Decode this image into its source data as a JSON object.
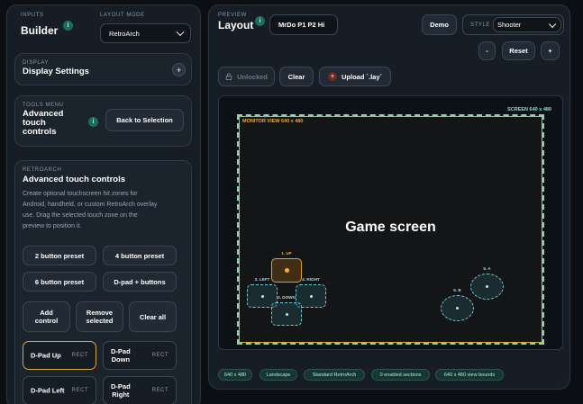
{
  "inputs": {
    "eyebrow": "INPUTS",
    "title": "Builder",
    "layout_mode_label": "LAYOUT MODE",
    "layout_mode_value": "RetroArch"
  },
  "display": {
    "eyebrow": "DISPLAY",
    "title": "Display Settings",
    "toggle": "+"
  },
  "tools": {
    "eyebrow": "TOOLS MENU",
    "title_line1": "Advanced",
    "title_line2": "touch",
    "title_line3": "controls",
    "back_label": "Back to Selection"
  },
  "retroarch": {
    "eyebrow": "RETROARCH",
    "title": "Advanced touch controls",
    "description_lines": [
      "Create optional touchscreen hit zones for",
      "Android, handheld, or custom RetroArch overlay",
      "use. Drag the selected touch zone on the",
      "preview to position it."
    ],
    "presets": [
      "2 button preset",
      "4 button preset",
      "6 button preset",
      "D-pad + buttons"
    ],
    "add_control": [
      "Add",
      "control"
    ],
    "remove_selected": [
      "Remove",
      "selected"
    ],
    "clear_all": "Clear all",
    "zones": [
      {
        "name": [
          "D-Pad Up"
        ],
        "type": "RECT",
        "active": true
      },
      {
        "name": [
          "D-Pad",
          "Down"
        ],
        "type": "RECT",
        "active": false
      },
      {
        "name": [
          "D-Pad Left"
        ],
        "type": "RECT",
        "active": false
      },
      {
        "name": [
          "D-Pad",
          "Right"
        ],
        "type": "RECT",
        "active": false
      }
    ]
  },
  "preview": {
    "eyebrow": "PREVIEW",
    "title": "Layout",
    "game_name": "MrDo P1 P2 Hi",
    "demo_label": "Demo",
    "style_label": "STYLE",
    "style_value": "Shooter",
    "zoom_out": "-",
    "reset_label": "Reset",
    "zoom_in": "+",
    "unlocked_label": "Unlocked",
    "clear_label": "Clear",
    "upload_label": "Upload `.lay`",
    "screen_label": "SCREEN 640 x 480",
    "monitor_label": "MONITOR VIEW 640 x 480",
    "game_screen_label": "Game screen",
    "zones": {
      "up": "1. UP",
      "left": "3. LEFT",
      "right": "4. RIGHT",
      "down": "2. DOWN",
      "a": "5. A",
      "b": "6. B"
    },
    "chips": [
      "640 x 480",
      "Landscape",
      "Standard RetroArch",
      "0 enabled sections",
      "640 x 480 view bounds"
    ]
  },
  "colors": {
    "accent_teal": "#6ec9d2",
    "accent_orange": "#e0a030",
    "active_border": "#d8a842",
    "chip_bg": "#173632"
  },
  "icons": {
    "info": "info-icon",
    "lock": "lock-icon",
    "upload": "upload-icon",
    "chevron": "chevron-down-icon"
  }
}
